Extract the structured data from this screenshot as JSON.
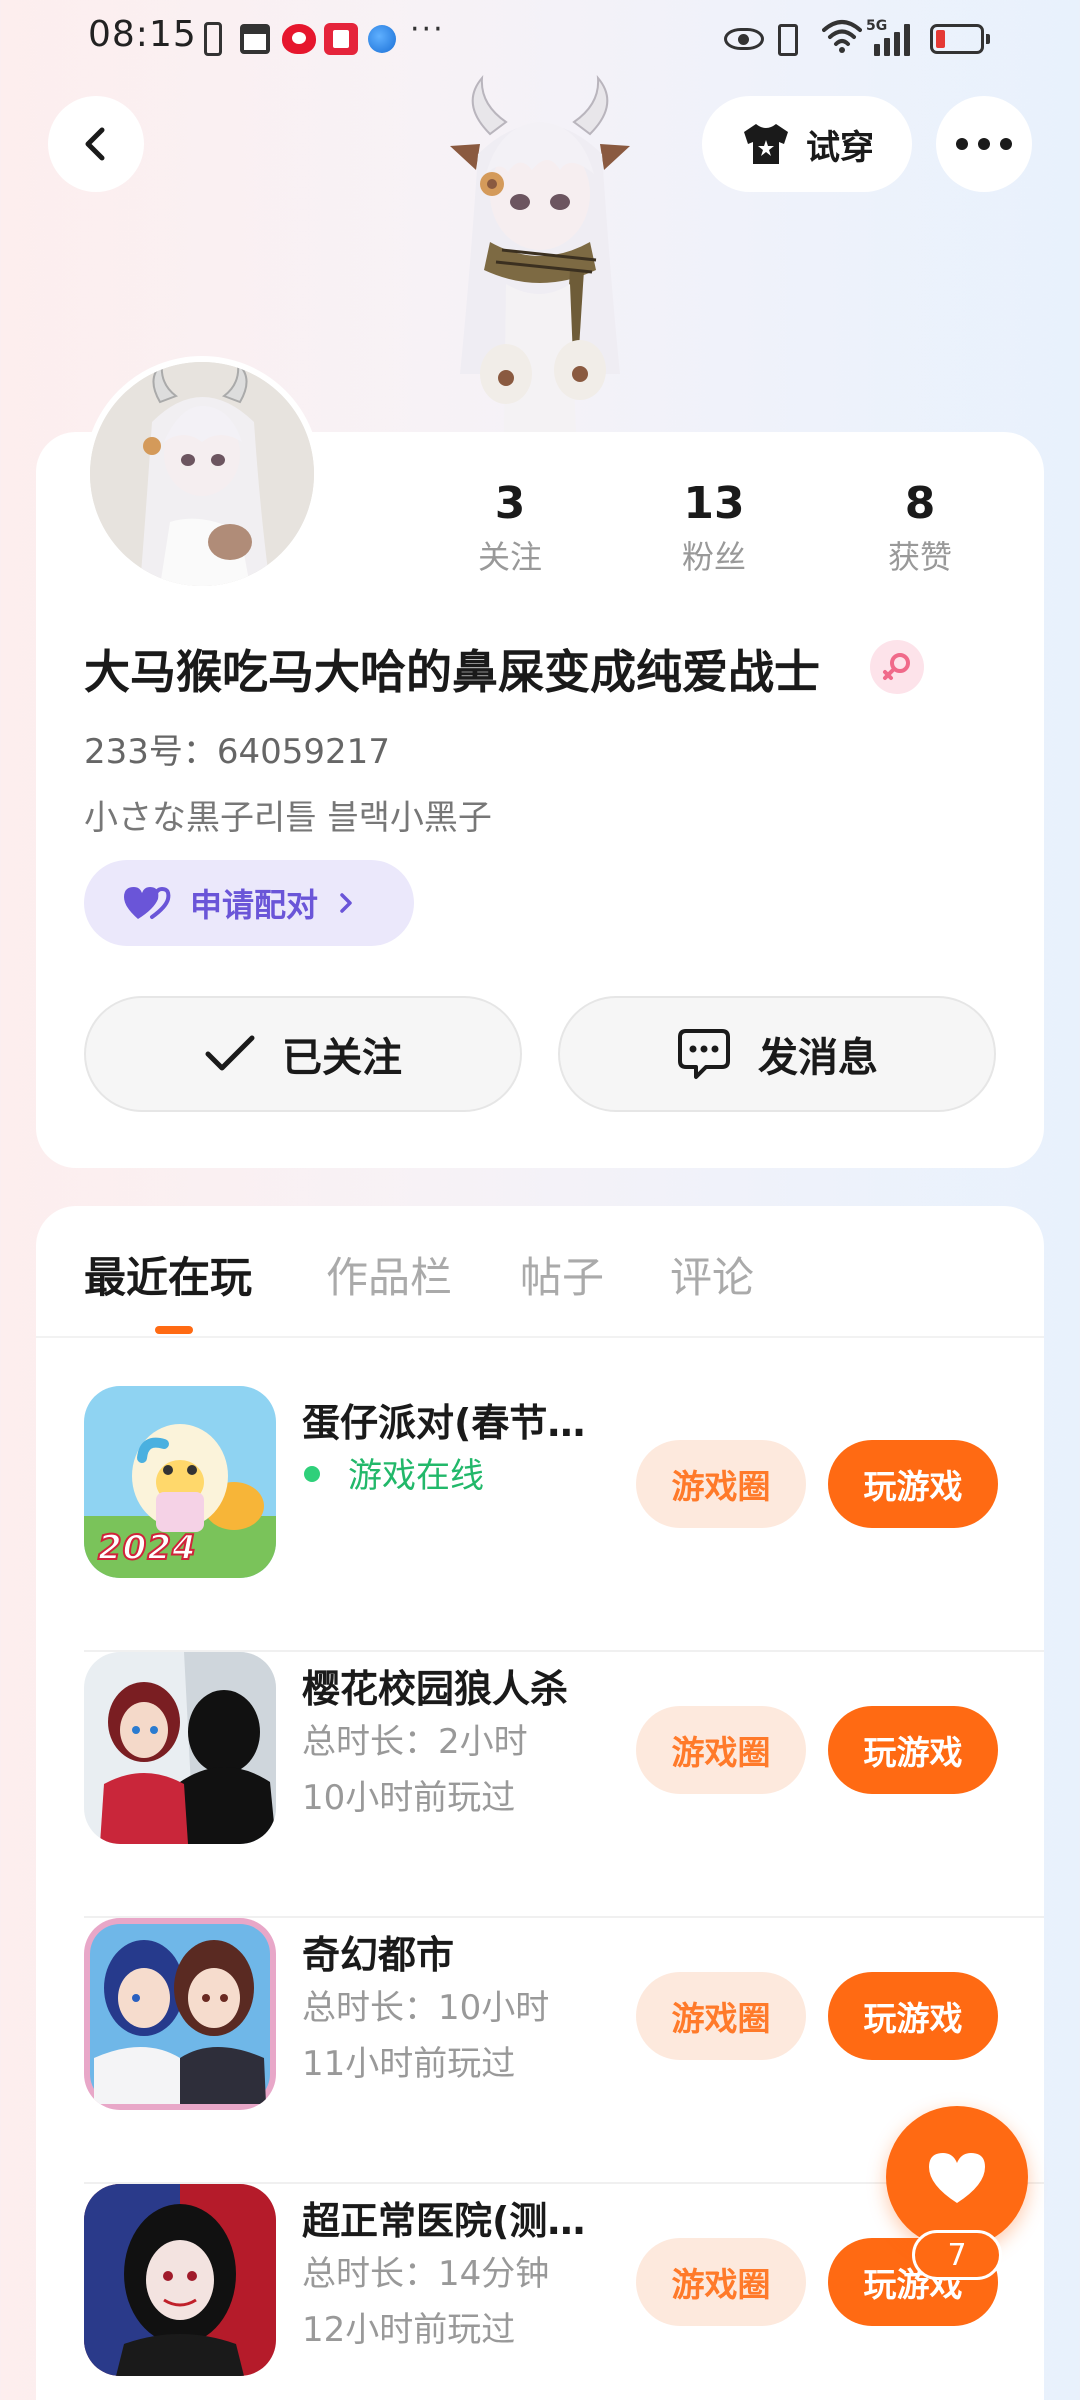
{
  "status_bar": {
    "time": "08:15",
    "network": "5G",
    "more_indicator": "···",
    "icons": [
      "phone-icon",
      "calendar-icon",
      "weibo-icon",
      "book-icon",
      "browser-icon",
      "eye-icon",
      "vibrate-icon",
      "wifi-icon",
      "signal-icon",
      "battery-icon"
    ]
  },
  "nav": {
    "back_icon": "chevron-left-icon",
    "tryon_label": "试穿",
    "tryon_icon": "tshirt-icon",
    "more_icon": "more-dots-icon"
  },
  "profile": {
    "username": "大马猴吃马大哈的鼻屎变成纯爱战士",
    "gender": "female",
    "id_line": "233号：64059217",
    "bio": "小さな黒子리틀 블랙小黑子",
    "pair_label": "申请配对",
    "stats": [
      {
        "value": "3",
        "label": "关注"
      },
      {
        "value": "13",
        "label": "粉丝"
      },
      {
        "value": "8",
        "label": "获赞"
      }
    ],
    "follow_label": "已关注",
    "message_label": "发消息"
  },
  "tabs": [
    {
      "label": "最近在玩",
      "active": true
    },
    {
      "label": "作品栏",
      "active": false
    },
    {
      "label": "帖子",
      "active": false
    },
    {
      "label": "评论",
      "active": false
    }
  ],
  "games": [
    {
      "title": "蛋仔派对(春节…",
      "status": "游戏在线",
      "online": true,
      "circle_label": "游戏圈",
      "play_label": "玩游戏"
    },
    {
      "title": "樱花校园狼人杀",
      "duration": "总时长：2小时",
      "last_played": "10小时前玩过",
      "circle_label": "游戏圈",
      "play_label": "玩游戏"
    },
    {
      "title": "奇幻都市",
      "duration": "总时长：10小时",
      "last_played": "11小时前玩过",
      "circle_label": "游戏圈",
      "play_label": "玩游戏"
    },
    {
      "title": "超正常医院(测…",
      "duration": "总时长：14分钟",
      "last_played": "12小时前玩过",
      "circle_label": "游戏圈",
      "play_label": "玩游戏"
    }
  ],
  "game1_thumb_text": "2024",
  "like_fab": {
    "icon": "heart-icon",
    "count": "7"
  },
  "colors": {
    "accent": "#ff6a13",
    "online": "#22b86a",
    "pair": "#6a55d8"
  }
}
